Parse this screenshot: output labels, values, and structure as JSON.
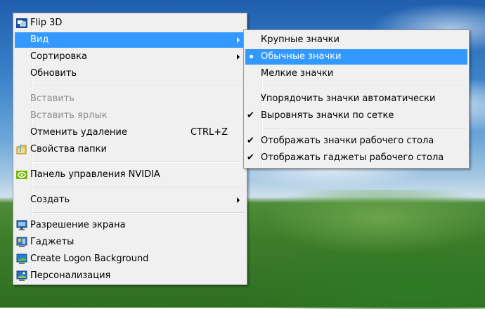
{
  "context_menu": {
    "items": [
      {
        "label": "Flip 3D",
        "icon": "flip3d-icon"
      },
      {
        "label": "Вид",
        "submenu": true
      },
      {
        "label": "Сортировка",
        "submenu": true
      },
      {
        "label": "Обновить"
      },
      {
        "label": "Вставить",
        "disabled": true
      },
      {
        "label": "Вставить ярлык",
        "disabled": true
      },
      {
        "label": "Отменить удаление",
        "shortcut": "CTRL+Z"
      },
      {
        "label": "Свойства папки",
        "icon": "folder-options-icon"
      },
      {
        "label": "Панель управления NVIDIA",
        "icon": "nvidia-icon"
      },
      {
        "label": "Создать",
        "submenu": true
      },
      {
        "label": "Разрешение экрана",
        "icon": "screen-resolution-icon"
      },
      {
        "label": "Гаджеты",
        "icon": "gadgets-icon"
      },
      {
        "label": "Create Logon Background",
        "icon": "logon-background-icon"
      },
      {
        "label": "Персонализация",
        "icon": "personalization-icon"
      }
    ]
  },
  "view_submenu": {
    "items": [
      {
        "label": "Крупные значки"
      },
      {
        "label": "Обычные значки",
        "selected": true
      },
      {
        "label": "Мелкие значки"
      },
      {
        "label": "Упорядочить значки автоматически"
      },
      {
        "label": "Выровнять значки по сетке",
        "checked": true
      },
      {
        "label": "Отображать значки рабочего стола",
        "checked": true
      },
      {
        "label": "Отображать гаджеты  рабочего стола",
        "checked": true
      }
    ]
  },
  "colors": {
    "highlight": "#3399ff",
    "menu_background": "#f0f0f0",
    "disabled_text": "#8d8d8d"
  }
}
